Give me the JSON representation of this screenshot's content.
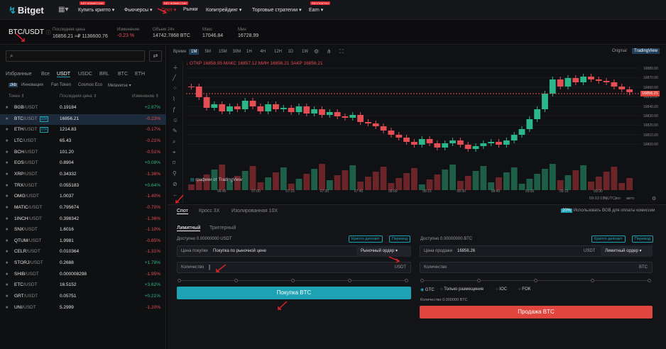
{
  "nav": {
    "logo": "Bitget",
    "items": [
      {
        "label": "Купить крипто ▾",
        "badge": "БЕЗ КОМИССИИ"
      },
      {
        "label": "Фьючерсы ▾",
        "badge": ""
      },
      {
        "label": "Спот ▾",
        "badge": "БЕЗ КОМИССИИ",
        "active": true
      },
      {
        "label": "Рынки",
        "badge": ""
      },
      {
        "label": "Копитрейдинг ▾",
        "badge": ""
      },
      {
        "label": "Торговые стратегии ▾",
        "badge": ""
      },
      {
        "label": "Earn ▾",
        "badge": "БЕСПЛАТНО"
      }
    ]
  },
  "pair": {
    "symbol": "BTC/USDT",
    "stats": [
      {
        "label": "Последняя цена",
        "value": "16856.21 ≈₽ 1136600.76",
        "color": "#c8c8c8"
      },
      {
        "label": "Изменение",
        "value": "-0.23 %",
        "color": "#e54d55"
      },
      {
        "label": "Объем 24ч",
        "value": "14742.7868 BTC",
        "color": "#c8c8c8"
      },
      {
        "label": "Макс",
        "value": "17046.84",
        "color": "#c8c8c8"
      },
      {
        "label": "Мин",
        "value": "16728.99",
        "color": "#c8c8c8"
      }
    ]
  },
  "market": {
    "tabs": [
      "Избранные",
      "Все",
      "USDT",
      "USDC",
      "BRL",
      "BTC",
      "ETH"
    ],
    "subtabs": [
      "zkb",
      "Инновации",
      "Fan Token",
      "Cosmos Eco",
      "Metaverse ▾"
    ],
    "headers": {
      "token": "Токен ⇕",
      "price": "Последняя цена ⇕",
      "change": "Изменение ⇕"
    },
    "rows": [
      {
        "sym": "BGB",
        "q": "/USDT",
        "lev": "",
        "price": "0.19184",
        "chg": "+2.87%",
        "up": true
      },
      {
        "sym": "BTC",
        "q": "/USDT",
        "lev": "10X",
        "price": "16856.21",
        "chg": "-0.23%",
        "up": false,
        "sel": true
      },
      {
        "sym": "ETH",
        "q": "/USDT",
        "lev": "10X",
        "price": "1214.83",
        "chg": "-0.17%",
        "up": false
      },
      {
        "sym": "LTC",
        "q": "/USDT",
        "lev": "",
        "price": "65.43",
        "chg": "-0.21%",
        "up": false
      },
      {
        "sym": "BCH",
        "q": "/USDT",
        "lev": "",
        "price": "101.20",
        "chg": "-0.51%",
        "up": false
      },
      {
        "sym": "EOS",
        "q": "/USDT",
        "lev": "",
        "price": "0.8904",
        "chg": "+0.09%",
        "up": true
      },
      {
        "sym": "XRP",
        "q": "/USDT",
        "lev": "",
        "price": "0.34332",
        "chg": "-1.36%",
        "up": false
      },
      {
        "sym": "TRX",
        "q": "/USDT",
        "lev": "",
        "price": "0.055183",
        "chg": "+0.64%",
        "up": true
      },
      {
        "sym": "OMG",
        "q": "/USDT",
        "lev": "",
        "price": "1.0037",
        "chg": "-1.40%",
        "up": false
      },
      {
        "sym": "MATIC",
        "q": "/USDT",
        "lev": "",
        "price": "0.795674",
        "chg": "-0.70%",
        "up": false
      },
      {
        "sym": "1INCH",
        "q": "/USDT",
        "lev": "",
        "price": "0.398342",
        "chg": "-1.36%",
        "up": false
      },
      {
        "sym": "SNX",
        "q": "/USDT",
        "lev": "",
        "price": "1.6016",
        "chg": "-1.10%",
        "up": false
      },
      {
        "sym": "QTUM",
        "q": "/USDT",
        "lev": "",
        "price": "1.9981",
        "chg": "-0.85%",
        "up": false
      },
      {
        "sym": "CELR",
        "q": "/USDT",
        "lev": "",
        "price": "0.010364",
        "chg": "-1.31%",
        "up": false
      },
      {
        "sym": "STORJ",
        "q": "/USDT",
        "lev": "",
        "price": "0.2688",
        "chg": "+1.78%",
        "up": true
      },
      {
        "sym": "SHIB",
        "q": "/USDT",
        "lev": "",
        "price": "0.000008298",
        "chg": "-1.95%",
        "up": false
      },
      {
        "sym": "ETC",
        "q": "/USDT",
        "lev": "",
        "price": "16.5152",
        "chg": "+3.62%",
        "up": true
      },
      {
        "sym": "GRT",
        "q": "/USDT",
        "lev": "",
        "price": "0.05751",
        "chg": "+0.21%",
        "up": true
      },
      {
        "sym": "UNI",
        "q": "/USDT",
        "lev": "",
        "price": "5.2999",
        "chg": "-1.20%",
        "up": false
      }
    ]
  },
  "chart": {
    "time_label": "Время",
    "timeframes": [
      "1M",
      "5M",
      "15M",
      "30M",
      "1H",
      "4H",
      "12H",
      "1D",
      "1W"
    ],
    "view_original": "Original",
    "view_tv": "TradingView",
    "ohlc": "↓ ОТКР 16856.95  МАКС 16857.12  МИН 16856.21  ЗАКР 16856.21",
    "current_price": "16856.21",
    "yticks": [
      "16880.00",
      "16870.00",
      "16860.00",
      "16850.00",
      "16840.00",
      "16830.00",
      "16820.00",
      "16810.00",
      "16800.00"
    ],
    "xticks": [
      "06:45",
      "07:00",
      "07:15",
      "07:30",
      "07:45",
      "08:00",
      "08:15",
      "08:30",
      "08:45",
      "09:00",
      "09:15",
      "09:30"
    ],
    "clock": "09:22:19 (UTC)",
    "axis_opts": [
      "%",
      "лог",
      "авто"
    ],
    "tv_credit": "графики от TradingView"
  },
  "trade": {
    "tabs": [
      "Спот",
      "Кросс 3X",
      "Изолированная 10X"
    ],
    "bgb_note": "Использовать BGB для оплаты комиссии",
    "bgb_pct": "20%",
    "order_types": [
      "Лимитный",
      "Триггерный"
    ],
    "buy": {
      "available": "Доступно 0.00000000 USDT",
      "deposit": "Крипто депозит",
      "transfer": "Перевод",
      "price_label": "Цена покупки",
      "price_value": "Покупка по рыночной цене",
      "order_type": "Рыночный ордер ▾",
      "qty_label": "Количество",
      "qty_unit": "USDT",
      "button": "Покупка BTC"
    },
    "sell": {
      "available": "Доступно 0.00000000 BTC",
      "deposit": "Крипто депозит",
      "transfer": "Перевод",
      "price_label": "Цена продажи",
      "price_value": "16856.26",
      "price_unit": "USDT",
      "order_type": "Лимитный ордер ▾",
      "qty_label": "Количество",
      "qty_unit": "BTC",
      "tif": [
        "GTC",
        "Только размещение",
        "IOC",
        "FOK"
      ],
      "qty_info": "Количество 0.000000 BTC",
      "button": "Продажа BTC"
    }
  }
}
